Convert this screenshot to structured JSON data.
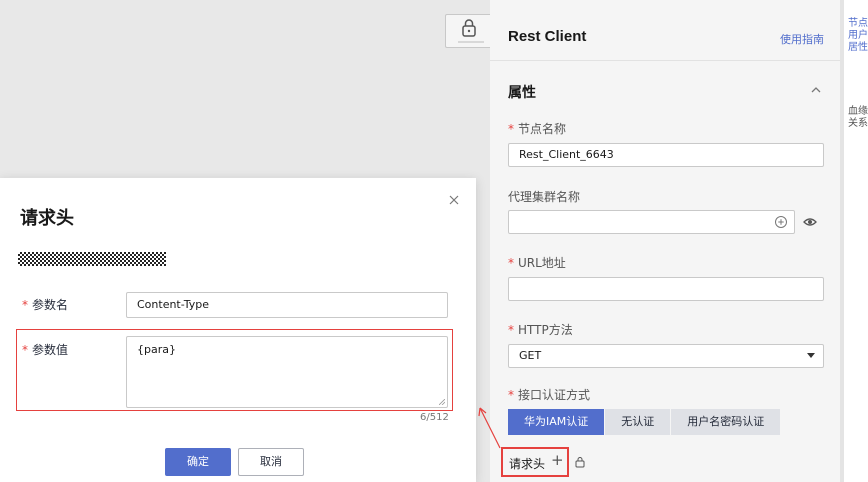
{
  "colors": {
    "accent": "#526ecc",
    "required": "#e5413e",
    "annotation": "#e5413e",
    "canvas": "#e8e8e8",
    "panel": "#f5f5f5"
  },
  "canvas": {
    "node_icon": "lock-icon"
  },
  "panel": {
    "title": "Rest Client",
    "guide_link": "使用指南",
    "section_title": "属性",
    "section_toggle_icon": "chevron-up-icon",
    "required_mark": "*",
    "node_name": {
      "label": "节点名称",
      "value": "Rest_Client_6643"
    },
    "proxy_cluster": {
      "label": "代理集群名称",
      "value": "",
      "add_icon": "plus-circle-icon",
      "view_icon": "eye-icon"
    },
    "url": {
      "label": "URL地址",
      "value": ""
    },
    "http_method": {
      "label": "HTTP方法",
      "value": "GET",
      "arrow_icon": "caret-down-icon"
    },
    "auth": {
      "label": "接口认证方式",
      "options": [
        "华为IAM认证",
        "无认证",
        "用户名密码认证"
      ],
      "selected": "华为IAM认证"
    },
    "request_header": {
      "label": "请求头",
      "add_icon": "plus-icon",
      "extra_icon": "lock-icon"
    }
  },
  "side_note": {
    "text1": "节点用户居性",
    "text2": "血缘关系"
  },
  "dialog": {
    "title": "请求头",
    "close_icon": "close-icon",
    "masked_text_icon": "redacted-block",
    "required_mark": "*",
    "param_name": {
      "label": "参数名",
      "value": "Content-Type"
    },
    "param_value": {
      "label": "参数值",
      "value": "{para}",
      "counter": "6/512"
    },
    "confirm": "确定",
    "cancel": "取消"
  }
}
